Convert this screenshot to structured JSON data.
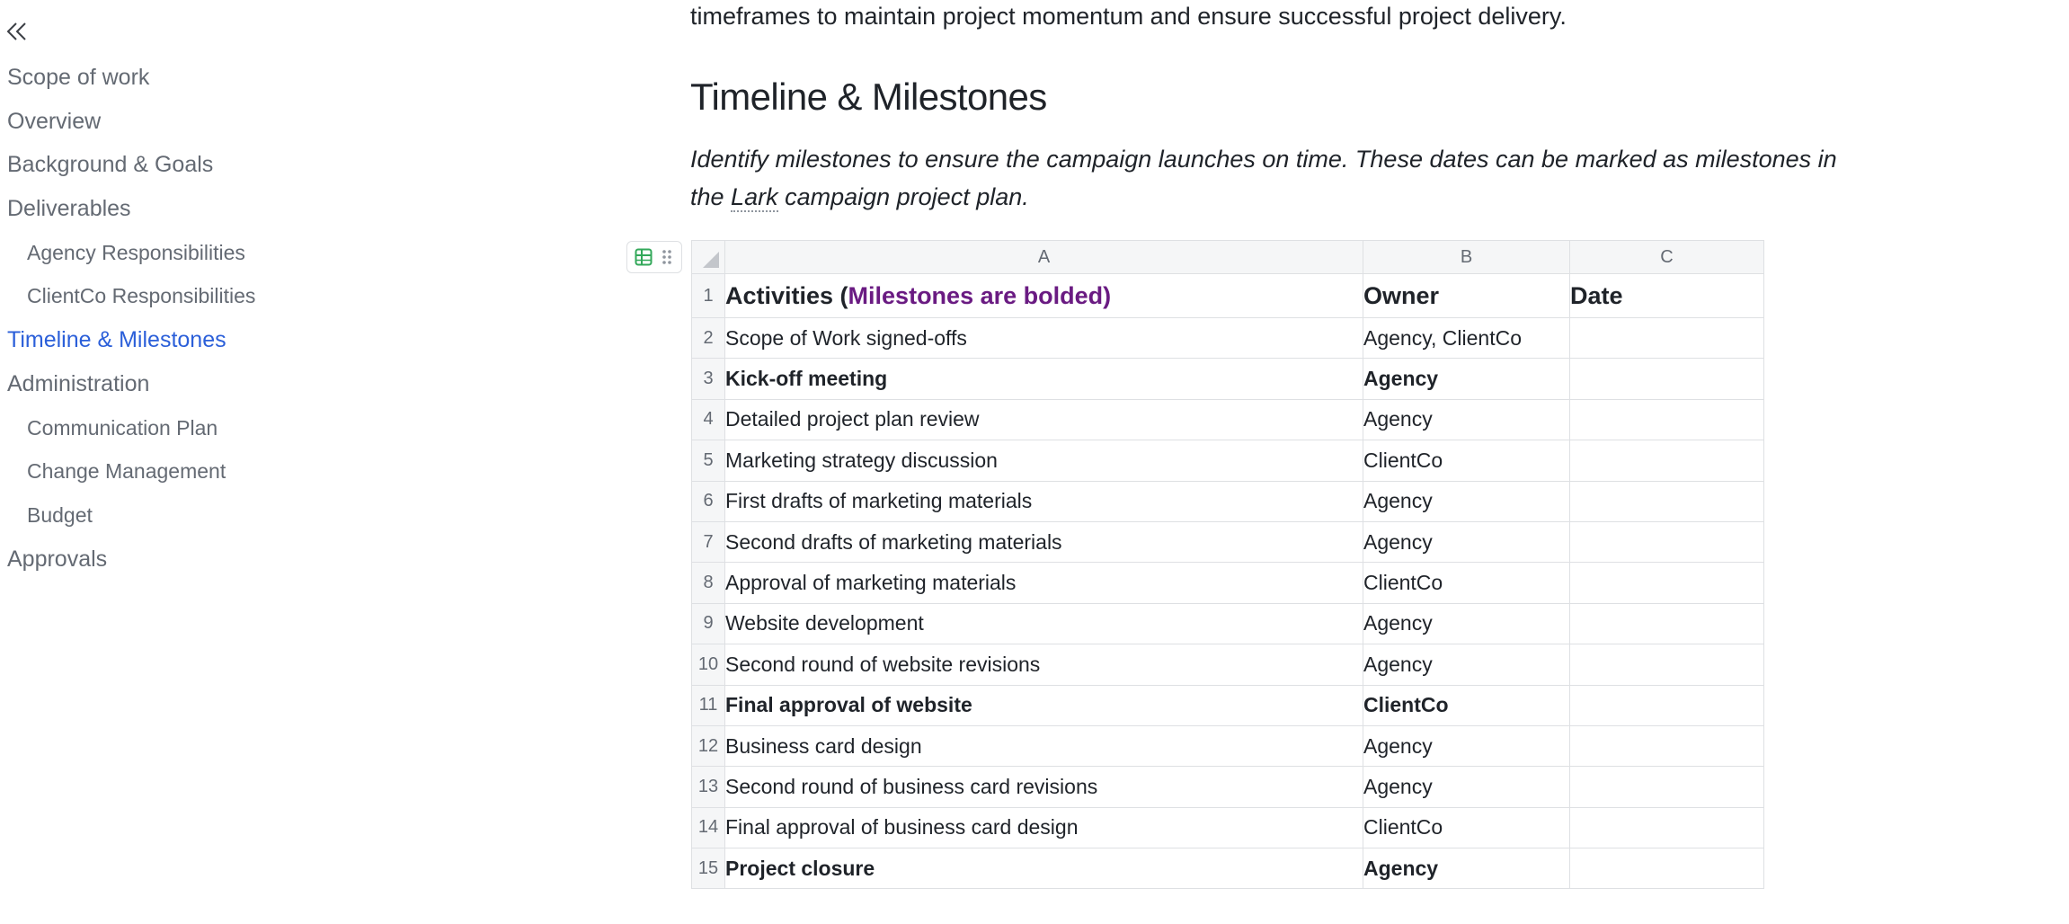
{
  "outline": {
    "items": [
      {
        "label": "Scope of work",
        "level": 0
      },
      {
        "label": "Overview",
        "level": 0
      },
      {
        "label": "Background & Goals",
        "level": 0
      },
      {
        "label": "Deliverables",
        "level": 0
      },
      {
        "label": "Agency Responsibilities",
        "level": 1
      },
      {
        "label": "ClientCo Responsibilities",
        "level": 1
      },
      {
        "label": "Timeline & Milestones",
        "level": 0,
        "active": true
      },
      {
        "label": "Administration",
        "level": 0
      },
      {
        "label": "Communication Plan",
        "level": 1
      },
      {
        "label": "Change Management",
        "level": 1
      },
      {
        "label": "Budget",
        "level": 1
      },
      {
        "label": "Approvals",
        "level": 0
      }
    ],
    "active_color": "#2b5fd9"
  },
  "doc": {
    "intro_tail": "timeframes to maintain project momentum and ensure successful project delivery.",
    "heading": "Timeline & Milestones",
    "desc_part1": "Identify milestones to ensure the campaign launches on time. These dates can be marked as milestones in the ",
    "desc_lark": "Lark",
    "desc_part2": " campaign project plan."
  },
  "sheet": {
    "columns": [
      "A",
      "B",
      "C"
    ],
    "header": {
      "row_num": "1",
      "activities_prefix": "Activities (",
      "activities_note": "Milestones are bolded)",
      "owner": "Owner",
      "date": "Date"
    },
    "rows": [
      {
        "num": "2",
        "activity": "Scope of Work signed-offs",
        "owner": "Agency, ClientCo",
        "date": "",
        "milestone": false
      },
      {
        "num": "3",
        "activity": "Kick-off meeting",
        "owner": "Agency",
        "date": "",
        "milestone": true
      },
      {
        "num": "4",
        "activity": "Detailed project plan review",
        "owner": "Agency",
        "date": "",
        "milestone": false
      },
      {
        "num": "5",
        "activity": "Marketing strategy discussion",
        "owner": "ClientCo",
        "date": "",
        "milestone": false
      },
      {
        "num": "6",
        "activity": "First drafts of marketing materials",
        "owner": "Agency",
        "date": "",
        "milestone": false
      },
      {
        "num": "7",
        "activity": "Second drafts of marketing materials",
        "owner": "Agency",
        "date": "",
        "milestone": false
      },
      {
        "num": "8",
        "activity": "Approval of marketing materials",
        "owner": "ClientCo",
        "date": "",
        "milestone": false
      },
      {
        "num": "9",
        "activity": "Website development",
        "owner": "Agency",
        "date": "",
        "milestone": false
      },
      {
        "num": "10",
        "activity": "Second round of website revisions",
        "owner": "Agency",
        "date": "",
        "milestone": false
      },
      {
        "num": "11",
        "activity": "Final approval of website",
        "owner": "ClientCo",
        "date": "",
        "milestone": true
      },
      {
        "num": "12",
        "activity": "Business card design",
        "owner": "Agency",
        "date": "",
        "milestone": false
      },
      {
        "num": "13",
        "activity": "Second round of business card revisions",
        "owner": "Agency",
        "date": "",
        "milestone": false
      },
      {
        "num": "14",
        "activity": "Final approval of business card design",
        "owner": "ClientCo",
        "date": "",
        "milestone": false
      },
      {
        "num": "15",
        "activity": "Project closure",
        "owner": "Agency",
        "date": "",
        "milestone": true
      }
    ],
    "milestone_note_color": "#6a1b82"
  },
  "icons": {
    "collapse": "double-chevron-left-icon",
    "table": "table-grid-icon",
    "drag": "drag-handle-icon",
    "corner": "select-all-corner-icon"
  }
}
